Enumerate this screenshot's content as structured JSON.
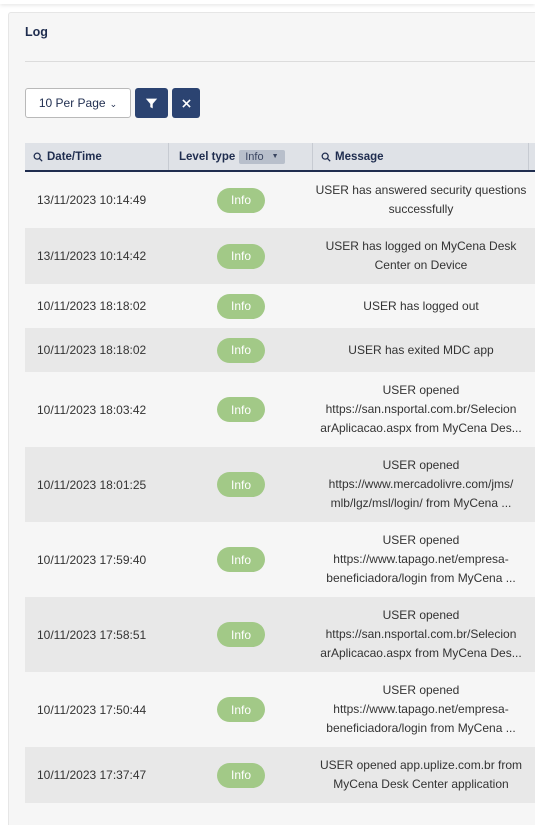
{
  "panel": {
    "title": "Log"
  },
  "toolbar": {
    "per_page_label": "10 Per Page",
    "filter_icon": "filter-icon",
    "clear_icon": "close-icon"
  },
  "table": {
    "columns": {
      "datetime": "Date/Time",
      "level": "Level type",
      "level_filter_value": "Info",
      "message": "Message"
    },
    "rows": [
      {
        "datetime": "13/11/2023 10:14:49",
        "level": "Info",
        "message": "USER has answered security questions successfully"
      },
      {
        "datetime": "13/11/2023 10:14:42",
        "level": "Info",
        "message": "USER has logged on MyCena Desk Center on Device"
      },
      {
        "datetime": "10/11/2023 18:18:02",
        "level": "Info",
        "message": "USER has logged out"
      },
      {
        "datetime": "10/11/2023 18:18:02",
        "level": "Info",
        "message": "USER has exited MDC app"
      },
      {
        "datetime": "10/11/2023 18:03:42",
        "level": "Info",
        "message": "USER opened https://san.nsportal.com.br/Selecion arAplicacao.aspx from MyCena Des..."
      },
      {
        "datetime": "10/11/2023 18:01:25",
        "level": "Info",
        "message": "USER opened https://www.mercadolivre.com/jms/ mlb/lgz/msl/login/ from MyCena ..."
      },
      {
        "datetime": "10/11/2023 17:59:40",
        "level": "Info",
        "message": "USER opened https://www.tapago.net/empresa- beneficiadora/login from MyCena ..."
      },
      {
        "datetime": "10/11/2023 17:58:51",
        "level": "Info",
        "message": "USER opened https://san.nsportal.com.br/Selecion arAplicacao.aspx from MyCena Des..."
      },
      {
        "datetime": "10/11/2023 17:50:44",
        "level": "Info",
        "message": "USER opened https://www.tapago.net/empresa- beneficiadora/login from MyCena ..."
      },
      {
        "datetime": "10/11/2023 17:37:47",
        "level": "Info",
        "message": "USER opened app.uplize.com.br from MyCena Desk Center application"
      }
    ]
  },
  "colors": {
    "primary": "#2b4371",
    "badge_info": "#a2c987",
    "header_bg": "#dfe2e7",
    "row_alt": "#e8e8e8"
  }
}
